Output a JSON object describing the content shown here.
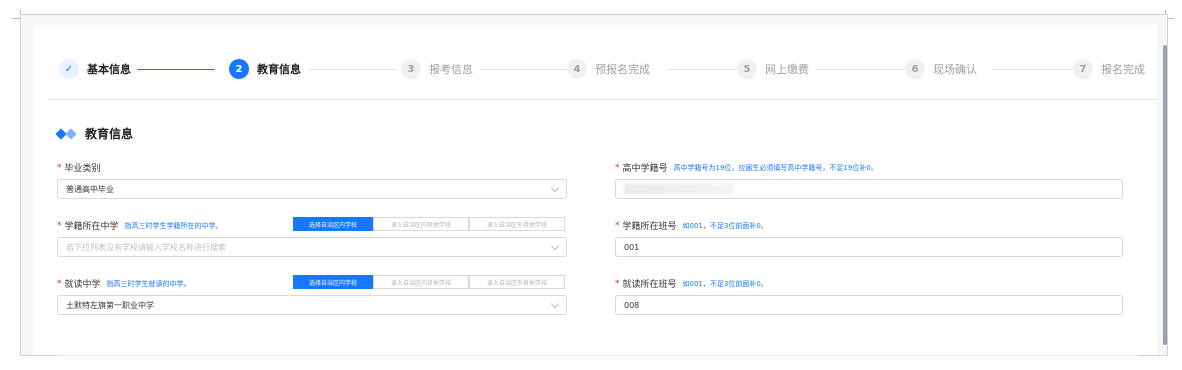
{
  "steps": [
    {
      "number": "✓",
      "label": "基本信息",
      "state": "done"
    },
    {
      "number": "2",
      "label": "教育信息",
      "state": "active"
    },
    {
      "number": "3",
      "label": "报考信息",
      "state": "todo"
    },
    {
      "number": "4",
      "label": "预报名完成",
      "state": "todo"
    },
    {
      "number": "5",
      "label": "网上缴费",
      "state": "todo"
    },
    {
      "number": "6",
      "label": "现场确认",
      "state": "todo"
    },
    {
      "number": "7",
      "label": "报名完成",
      "state": "todo"
    }
  ],
  "section": {
    "title": "教育信息"
  },
  "form": {
    "graduation_type": {
      "label": "毕业类别",
      "value": "普通高中毕业"
    },
    "student_no": {
      "label": "高中学籍号",
      "hint": "高中学籍号为19位，应届生必须填写高中学籍号，不足19位补0。",
      "value": ""
    },
    "school_of_record": {
      "label": "学籍所在中学",
      "hint": "指高三时学生学籍所在的中学。",
      "options": [
        "选择自治区内学校",
        "录入自治区内其他学校",
        "录入自治区外其他学校"
      ],
      "placeholder": "若下拉列表没有学校请输入学校名称进行搜索"
    },
    "record_class": {
      "label": "学籍所在班号",
      "hint": "如001，不足3位前面补0。",
      "value": "001"
    },
    "school_attended": {
      "label": "就读中学",
      "hint": "指高三时学生就读的中学。",
      "options": [
        "选择自治区内学校",
        "录入自治区内其他学校",
        "录入自治区外其他学校"
      ],
      "value": "土默特左旗第一职业中学"
    },
    "attended_class": {
      "label": "就读所在班号",
      "hint": "如001，不足3位前面补0。",
      "value": "008"
    }
  },
  "colors": {
    "accent": "#1677ff",
    "required": "#f5222d"
  }
}
